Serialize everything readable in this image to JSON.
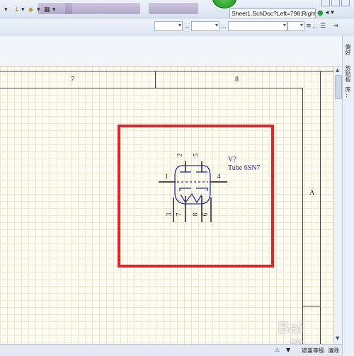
{
  "browser": {
    "address_text": "Sheet1.SchDoc?Left=798;Right=",
    "address_tools": {
      "go": "●",
      "back": "◂",
      "menu": "▾"
    }
  },
  "toolbar": {
    "tool_arrow_1": "▾",
    "tool_pin": "↓",
    "tool_arrow_2": "▾",
    "tool_diamond": "◆",
    "tool_arrow_3": "▾",
    "tool_grid": "▦",
    "tool_arrow_4": "▾"
  },
  "format_bar": {
    "dots_1": "...",
    "dots_2": "...",
    "dots_3": "...",
    "align_icon": "≡",
    "bullets_icon": "☰",
    "indent_icon": "⇥"
  },
  "sheet": {
    "zone_cols": [
      "7",
      "8"
    ],
    "zone_row": "A"
  },
  "component": {
    "designator": "V?",
    "comment": "Tube 6SN7",
    "pins": {
      "p1": "1",
      "p2": "2",
      "p3": "3",
      "p4": "4",
      "p5": "5",
      "p6": "6",
      "p7": "7",
      "p8": "8"
    },
    "color": "#2c2c9a",
    "highlight_color": "#d9272c"
  },
  "right_panel": {
    "tabs": [
      "偏好",
      "剪贴板",
      "库..."
    ]
  },
  "status_bar": {
    "icon_1": "⚠",
    "icon_2": "▼",
    "mask_label": "遮盖等级",
    "clear_label": "清除"
  },
  "watermark": {
    "text": "Bai",
    "sub": "经验"
  }
}
